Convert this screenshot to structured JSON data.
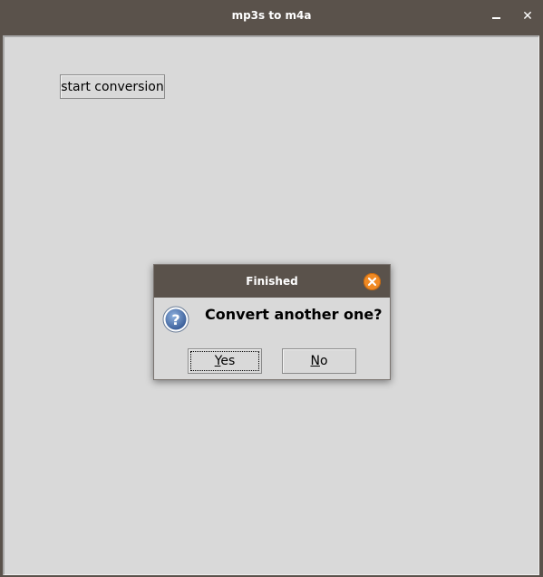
{
  "window": {
    "title": "mp3s to m4a",
    "minimize_icon": "minimize-icon",
    "close_icon": "close-icon"
  },
  "main": {
    "start_button_label": "start conversion"
  },
  "dialog": {
    "title": "Finished",
    "message": "Convert another one?",
    "icon": "question-icon",
    "close_icon": "close-icon",
    "close_color": "#f08a24",
    "yes_mnemonic": "Y",
    "yes_rest": "es",
    "no_mnemonic": "N",
    "no_rest": "o"
  },
  "colors": {
    "titlebar": "#5a524b",
    "background": "#d9d9d9"
  }
}
